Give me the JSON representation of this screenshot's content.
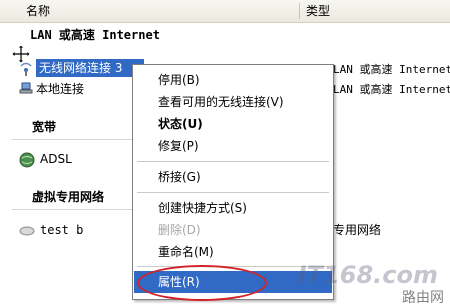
{
  "header": {
    "name_col": "名称",
    "type_col": "类型"
  },
  "groups": {
    "lan": "LAN 或高速 Internet",
    "broadband": "宽带",
    "vpn": "虚拟专用网络"
  },
  "items": {
    "wireless": {
      "label": "无线网络连接 3",
      "type": "LAN 或高速 Internet"
    },
    "local": {
      "label": "本地连接",
      "type": "LAN 或高速 Internet"
    },
    "adsl": {
      "label": "ADSL"
    },
    "testb": {
      "label": "test b",
      "type": "专用网络"
    }
  },
  "context_menu": {
    "items": [
      {
        "label": "停用(B)"
      },
      {
        "label": "查看可用的无线连接(V)"
      },
      {
        "label": "状态(U)"
      },
      {
        "label": "修复(P)"
      },
      {
        "label": "桥接(G)"
      },
      {
        "label": "创建快捷方式(S)"
      },
      {
        "label": "删除(D)"
      },
      {
        "label": "重命名(M)"
      },
      {
        "label": "属性(R)"
      }
    ]
  },
  "watermark": {
    "logo": "IT168.com",
    "site": "路由网"
  },
  "colors": {
    "highlight": "#316ac5",
    "annotation": "#d2232a"
  }
}
